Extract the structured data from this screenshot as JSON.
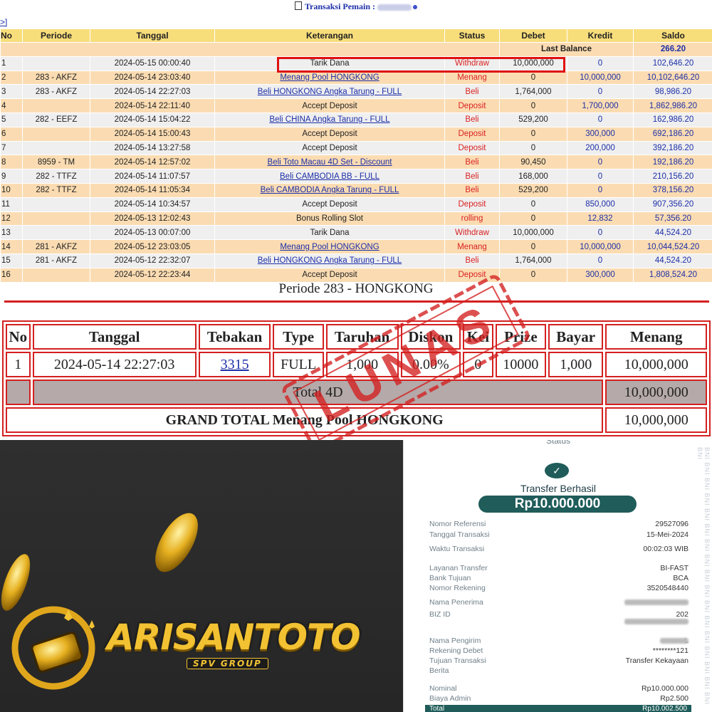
{
  "header": {
    "title": "Transaksi Pemain :",
    "nav": ">]"
  },
  "table": {
    "columns": [
      "No",
      "Periode",
      "Tanggal",
      "Keterangan",
      "Status",
      "Debet",
      "Kredit",
      "Saldo"
    ],
    "last_balance_label": "Last Balance",
    "last_balance_value": "266.20",
    "rows": [
      {
        "no": "1",
        "periode": "",
        "tanggal": "2024-05-15 00:00:40",
        "ket": "Tarik Dana",
        "link": false,
        "status": "Withdraw",
        "debet": "10,000,000",
        "kredit": "0",
        "saldo": "102,646.20"
      },
      {
        "no": "2",
        "periode": "283 - AKFZ",
        "tanggal": "2024-05-14 23:03:40",
        "ket": "Menang Pool HONGKONG",
        "link": true,
        "status": "Menang",
        "debet": "0",
        "kredit": "10,000,000",
        "saldo": "10,102,646.20"
      },
      {
        "no": "3",
        "periode": "283 - AKFZ",
        "tanggal": "2024-05-14 22:27:03",
        "ket": "Beli HONGKONG Angka Tarung - FULL",
        "link": true,
        "status": "Beli",
        "debet": "1,764,000",
        "kredit": "0",
        "saldo": "98,986.20"
      },
      {
        "no": "4",
        "periode": "",
        "tanggal": "2024-05-14 22:11:40",
        "ket": "Accept Deposit",
        "link": false,
        "status": "Deposit",
        "debet": "0",
        "kredit": "1,700,000",
        "saldo": "1,862,986.20"
      },
      {
        "no": "5",
        "periode": "282 - EEFZ",
        "tanggal": "2024-05-14 15:04:22",
        "ket": "Beli CHINA Angka Tarung - FULL",
        "link": true,
        "status": "Beli",
        "debet": "529,200",
        "kredit": "0",
        "saldo": "162,986.20"
      },
      {
        "no": "6",
        "periode": "",
        "tanggal": "2024-05-14 15:00:43",
        "ket": "Accept Deposit",
        "link": false,
        "status": "Deposit",
        "debet": "0",
        "kredit": "300,000",
        "saldo": "692,186.20"
      },
      {
        "no": "7",
        "periode": "",
        "tanggal": "2024-05-14 13:27:58",
        "ket": "Accept Deposit",
        "link": false,
        "status": "Deposit",
        "debet": "0",
        "kredit": "200,000",
        "saldo": "392,186.20"
      },
      {
        "no": "8",
        "periode": "8959 - TM",
        "tanggal": "2024-05-14 12:57:02",
        "ket": "Beli Toto Macau 4D Set - Discount",
        "link": true,
        "status": "Beli",
        "debet": "90,450",
        "kredit": "0",
        "saldo": "192,186.20"
      },
      {
        "no": "9",
        "periode": "282 - TTFZ",
        "tanggal": "2024-05-14 11:07:57",
        "ket": "Beli CAMBODIA BB - FULL",
        "link": true,
        "status": "Beli",
        "debet": "168,000",
        "kredit": "0",
        "saldo": "210,156.20"
      },
      {
        "no": "10",
        "periode": "282 - TTFZ",
        "tanggal": "2024-05-14 11:05:34",
        "ket": "Beli CAMBODIA Angka Tarung - FULL",
        "link": true,
        "status": "Beli",
        "debet": "529,200",
        "kredit": "0",
        "saldo": "378,156.20"
      },
      {
        "no": "11",
        "periode": "",
        "tanggal": "2024-05-14 10:34:57",
        "ket": "Accept Deposit",
        "link": false,
        "status": "Deposit",
        "debet": "0",
        "kredit": "850,000",
        "saldo": "907,356.20"
      },
      {
        "no": "12",
        "periode": "",
        "tanggal": "2024-05-13 12:02:43",
        "ket": "Bonus Rolling Slot",
        "link": false,
        "status": "rolling",
        "debet": "0",
        "kredit": "12,832",
        "saldo": "57,356.20"
      },
      {
        "no": "13",
        "periode": "",
        "tanggal": "2024-05-13 00:07:00",
        "ket": "Tarik Dana",
        "link": false,
        "status": "Withdraw",
        "debet": "10,000,000",
        "kredit": "0",
        "saldo": "44,524.20"
      },
      {
        "no": "14",
        "periode": "281 - AKFZ",
        "tanggal": "2024-05-12 23:03:05",
        "ket": "Menang Pool HONGKONG",
        "link": true,
        "status": "Menang",
        "debet": "0",
        "kredit": "10,000,000",
        "saldo": "10,044,524.20"
      },
      {
        "no": "15",
        "periode": "281 - AKFZ",
        "tanggal": "2024-05-12 22:32:07",
        "ket": "Beli HONGKONG Angka Tarung - FULL",
        "link": true,
        "status": "Beli",
        "debet": "1,764,000",
        "kredit": "0",
        "saldo": "44,524.20"
      },
      {
        "no": "16",
        "periode": "",
        "tanggal": "2024-05-12 22:23:44",
        "ket": "Accept Deposit",
        "link": false,
        "status": "Deposit",
        "debet": "0",
        "kredit": "300,000",
        "saldo": "1,808,524.20"
      }
    ]
  },
  "periode": {
    "title": "Periode 283 - HONGKONG"
  },
  "win": {
    "columns": [
      "No",
      "Tanggal",
      "Tebakan",
      "Type",
      "Taruhan",
      "Diskon",
      "Kei",
      "Prize",
      "Bayar",
      "Menang"
    ],
    "row": {
      "no": "1",
      "tanggal": "2024-05-14 22:27:03",
      "tebakan": "3315",
      "type": "FULL",
      "taruhan": "1,000",
      "diskon": "0.00%",
      "kei": "0",
      "prize": "10000",
      "bayar": "1,000",
      "menang": "10,000,000"
    },
    "total_label": "Total 4D",
    "total_value": "10,000,000",
    "grand_label": "GRAND TOTAL  Menang Pool HONGKONG",
    "grand_value": "10,000,000",
    "stamp_text": "LUNAS",
    "stamp_color": "#d42020"
  },
  "logo": {
    "name": "ARISANTOTO",
    "sub": "SPV GROUP",
    "gold": "#f2c233"
  },
  "receipt": {
    "status_label": "Status",
    "title": "Transfer Berhasil",
    "amount": "Rp10.000.000",
    "accent": "#1f5c5a",
    "rows": [
      {
        "k": "Nomor Referensi",
        "v": "29527096"
      },
      {
        "k": "Tanggal Transaksi",
        "v": "15-Mei-2024"
      },
      {
        "k": "Waktu Transaksi",
        "v": "00:02:03 WIB"
      },
      {
        "k": "Layanan Transfer",
        "v": "BI-FAST"
      },
      {
        "k": "Bank Tujuan",
        "v": "BCA"
      },
      {
        "k": "Nomor Rekening",
        "v": "3520548440"
      },
      {
        "k": "Nama Penerima",
        "v": ""
      },
      {
        "k": "BIZ ID",
        "v": "202"
      },
      {
        "k": "Nama Pengirim",
        "v": "L"
      },
      {
        "k": "Rekening Debet",
        "v": "********121"
      },
      {
        "k": "Tujuan Transaksi",
        "v": "Transfer Kekayaan"
      },
      {
        "k": "Berita",
        "v": ""
      },
      {
        "k": "Nominal",
        "v": "Rp10.000.000"
      },
      {
        "k": "Biaya Admin",
        "v": "Rp2.500"
      }
    ],
    "total_label": "Total",
    "total_value": "Rp10.002.500",
    "watermark": "BNI BNI BNI BNI BNI BNI BNI BNI BNI BNI BNI BNI BNI BNI BNI BNI BNI BNI"
  }
}
